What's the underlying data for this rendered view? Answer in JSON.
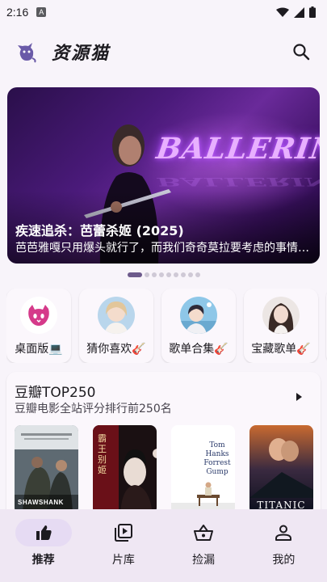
{
  "status_bar": {
    "time": "2:16",
    "notification_icon": "a-icon",
    "icons": [
      "wifi-icon",
      "signal-icon",
      "battery-icon"
    ]
  },
  "app_bar": {
    "title": "资源猫",
    "logo_icon": "cat-logo-icon",
    "search_icon": "search-icon"
  },
  "banner": {
    "title": "疾速追杀：芭蕾杀姬 (2025)",
    "subtitle": "芭芭雅嘎只用爆头就行了，而我们奇奇莫拉要考虑的事情就多了",
    "wordmark": "BALLERINA",
    "dot_count": 9,
    "active_dot": 0
  },
  "shortcuts": [
    {
      "label": "桌面版💻",
      "icon": "cat-icon"
    },
    {
      "label": "猜你喜欢🎸",
      "icon": "avatar-anime-girl"
    },
    {
      "label": "歌单合集🎸",
      "icon": "avatar-anime-boy"
    },
    {
      "label": "宝藏歌单🎸",
      "icon": "avatar-girl-portrait"
    }
  ],
  "section": {
    "title": "豆瓣TOP250",
    "subtitle": "豆瓣电影全站评分排行前250名",
    "arrow_icon": "play-arrow-icon",
    "posters": [
      {
        "name": "poster-shawshank",
        "text": "SHAWSHANK"
      },
      {
        "name": "poster-farewell-concubine",
        "text": "霸王别姬"
      },
      {
        "name": "poster-forrest-gump",
        "text": "Tom Hanks Forrest Gump"
      },
      {
        "name": "poster-titanic",
        "text": "TITANIC"
      }
    ]
  },
  "nav": {
    "items": [
      {
        "label": "推荐",
        "icon": "thumb-up-icon",
        "active": true
      },
      {
        "label": "片库",
        "icon": "video-library-icon",
        "active": false
      },
      {
        "label": "捡漏",
        "icon": "basket-icon",
        "active": false
      },
      {
        "label": "我的",
        "icon": "person-icon",
        "active": false
      }
    ]
  },
  "colors": {
    "background": "#f8f4fa",
    "nav_background": "#efe7f3",
    "active_pill": "#e6dbf3",
    "dot_active": "#6d5a8c",
    "dot_inactive": "#cfc9d6"
  }
}
